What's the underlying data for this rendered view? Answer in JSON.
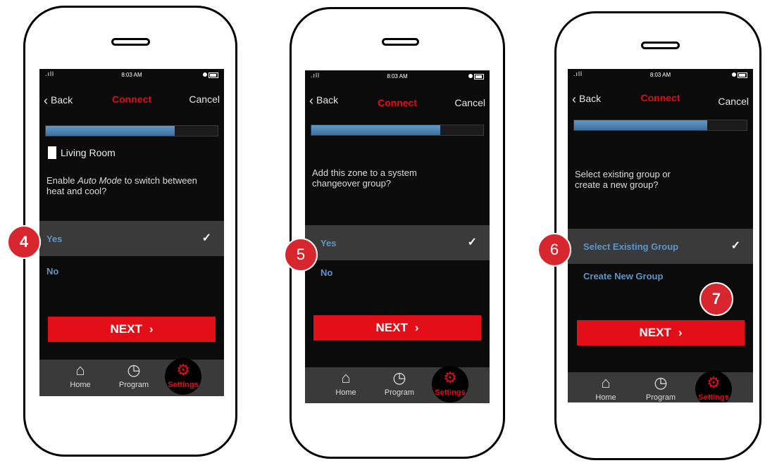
{
  "status": {
    "time": "8:03 AM",
    "signal": ".ıll"
  },
  "nav": {
    "back": "Back",
    "title": "Connect",
    "cancel": "Cancel"
  },
  "screens": [
    {
      "room": "Living Room",
      "prompt_pre": "Enable ",
      "prompt_em": "Auto Mode",
      "prompt_post": " to switch between heat and cool?",
      "options": [
        {
          "label": "Yes",
          "selected": true
        },
        {
          "label": "No",
          "selected": false
        }
      ],
      "progress": 0.75
    },
    {
      "prompt": "Add this zone to a system changeover group?",
      "options": [
        {
          "label": "Yes",
          "selected": true
        },
        {
          "label": "No",
          "selected": false
        }
      ],
      "progress": 0.75
    },
    {
      "prompt": "Select existing group or create a new group?",
      "options": [
        {
          "label": "Select Existing Group",
          "selected": true
        },
        {
          "label": "Create New Group",
          "selected": false
        }
      ],
      "progress": 0.75
    }
  ],
  "next_label": "NEXT",
  "tabs": {
    "home": "Home",
    "program": "Program",
    "settings": "Settings"
  },
  "badges": [
    "4",
    "5",
    "6",
    "7"
  ],
  "colors": {
    "accent_red": "#e30b17",
    "option_blue": "#5f95c7",
    "progress_blue": "#4d85b8"
  }
}
